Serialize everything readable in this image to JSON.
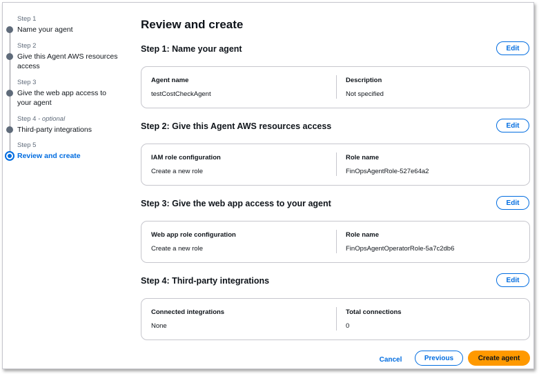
{
  "nav": {
    "steps": [
      {
        "num": "Step 1",
        "optional": "",
        "label": "Name your agent"
      },
      {
        "num": "Step 2",
        "optional": "",
        "label": "Give this Agent AWS resources access"
      },
      {
        "num": "Step 3",
        "optional": "",
        "label": "Give the web app access to your agent"
      },
      {
        "num": "Step 4",
        "optional": " - optional",
        "label": "Third-party integrations"
      },
      {
        "num": "Step 5",
        "optional": "",
        "label": "Review and create"
      }
    ],
    "active_step": 5
  },
  "main": {
    "title": "Review and create",
    "edit_label": "Edit",
    "sections": [
      {
        "heading": "Step 1: Name your agent",
        "fields": [
          {
            "key": "Agent name",
            "value": "testCostCheckAgent"
          },
          {
            "key": "Description",
            "value": "Not specified"
          }
        ]
      },
      {
        "heading": "Step 2: Give this Agent AWS resources access",
        "fields": [
          {
            "key": "IAM role configuration",
            "value": "Create a new role"
          },
          {
            "key": "Role name",
            "value": "FinOpsAgentRole-527e64a2"
          }
        ]
      },
      {
        "heading": "Step 3: Give the web app access to your agent",
        "fields": [
          {
            "key": "Web app role configuration",
            "value": "Create a new role"
          },
          {
            "key": "Role name",
            "value": "FinOpsAgentOperatorRole-5a7c2db6"
          }
        ]
      },
      {
        "heading": "Step 4: Third-party integrations",
        "fields": [
          {
            "key": "Connected integrations",
            "value": "None"
          },
          {
            "key": "Total connections",
            "value": "0"
          }
        ]
      }
    ]
  },
  "footer": {
    "cancel_label": "Cancel",
    "previous_label": "Previous",
    "create_label": "Create agent"
  },
  "colors": {
    "accent": "#006ce0",
    "primary_button": "#ff9900",
    "border": "#c6c6cd"
  }
}
